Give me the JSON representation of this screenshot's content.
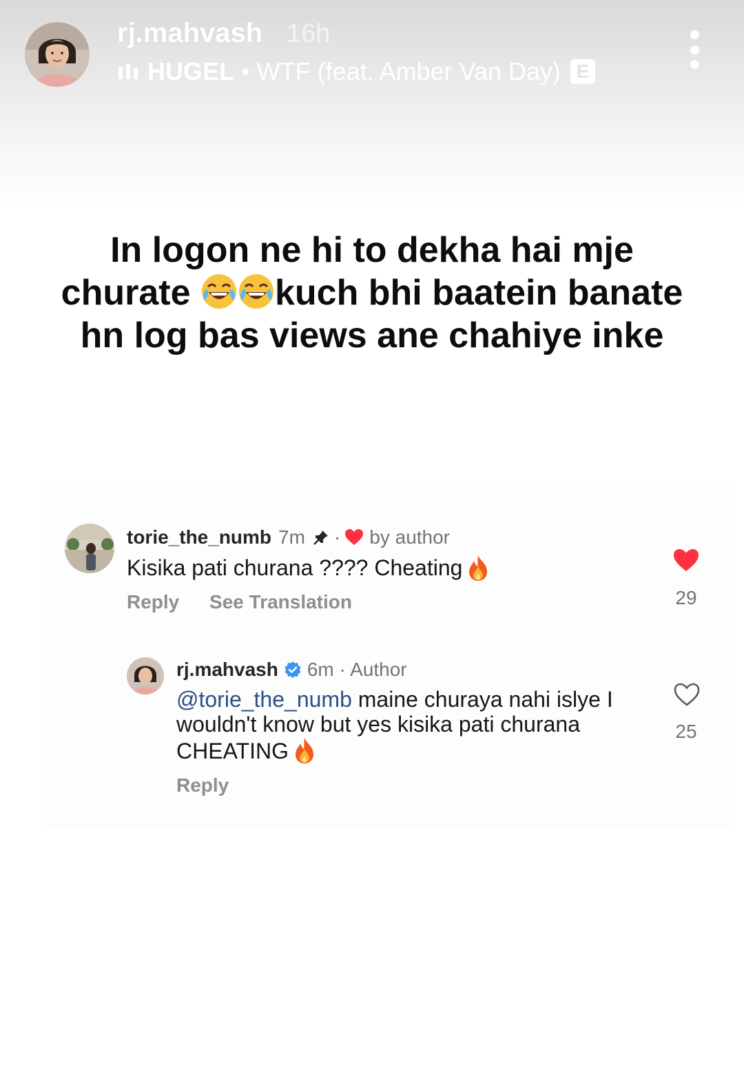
{
  "story": {
    "username": "rj.mahvash",
    "time": "16h",
    "music": {
      "artist": "HUGEL",
      "separator": "•",
      "title": "WTF (feat. Amber Van Day)",
      "explicit_label": "E"
    },
    "text_line1": "In logon ne hi to dekha hai mje",
    "text_line2_start": "churate",
    "text_line2_end": "kuch bhi baatein banate",
    "text_line3": "hn log bas views ane chahiye inke"
  },
  "comments": [
    {
      "username": "torie_the_numb",
      "time": "7m",
      "liked_by": "by author",
      "text": "Kisika pati churana ???? Cheating",
      "actions": {
        "reply": "Reply",
        "translate": "See Translation"
      },
      "likes": "29",
      "liked": true
    },
    {
      "username": "rj.mahvash",
      "meta": "6m · Author",
      "mention": "@torie_the_numb",
      "text": "maine churaya nahi islye I wouldn't know but yes kisika pati churana CHEATING",
      "actions": {
        "reply": "Reply"
      },
      "likes": "25",
      "liked": false
    }
  ],
  "colors": {
    "like_red": "#ff3040",
    "verified_blue": "#3897f0",
    "mention_blue": "#2b4f86"
  }
}
